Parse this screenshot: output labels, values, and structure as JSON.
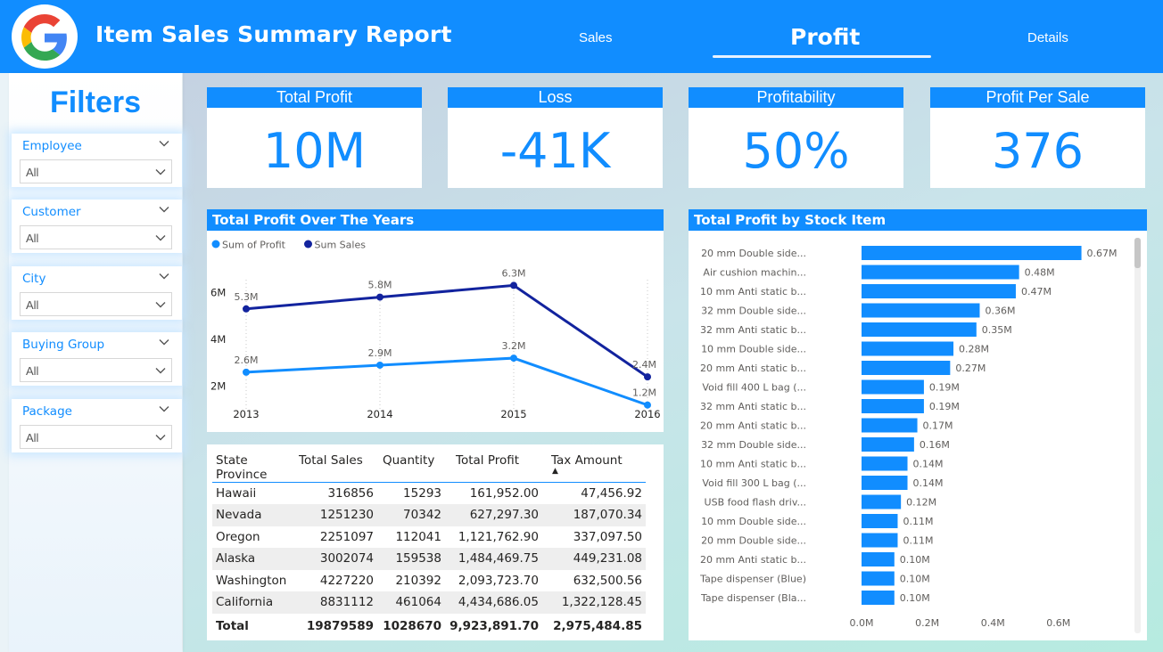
{
  "header": {
    "title": "Item Sales Summary Report",
    "nav": [
      "Sales",
      "Profit",
      "Details"
    ],
    "active_tab": "Profit",
    "logo_icon": "google-logo"
  },
  "filters": {
    "title": "Filters",
    "items": [
      {
        "label": "Employee",
        "value": "All"
      },
      {
        "label": "Customer",
        "value": "All"
      },
      {
        "label": "City",
        "value": "All"
      },
      {
        "label": "Buying Group",
        "value": "All"
      },
      {
        "label": "Package",
        "value": "All"
      }
    ]
  },
  "kpis": [
    {
      "label": "Total Profit",
      "value": "10M"
    },
    {
      "label": "Loss",
      "value": "-41K"
    },
    {
      "label": "Profitability",
      "value": "50%"
    },
    {
      "label": "Profit Per Sale",
      "value": "376"
    }
  ],
  "colors": {
    "accent": "#118DFF",
    "dark_series": "#12239E"
  },
  "line_panel": {
    "title": "Total Profit Over The Years"
  },
  "bar_panel": {
    "title": "Total Profit by Stock Item"
  },
  "table": {
    "columns": [
      "State Province",
      "Total Sales",
      "Quantity",
      "Total Profit",
      "Tax Amount"
    ],
    "sort_indicator": "▲",
    "rows": [
      [
        "Hawaii",
        "316856",
        "15293",
        "161,952.00",
        "47,456.92"
      ],
      [
        "Nevada",
        "1251230",
        "70342",
        "627,297.30",
        "187,070.34"
      ],
      [
        "Oregon",
        "2251097",
        "112041",
        "1,121,762.90",
        "337,097.50"
      ],
      [
        "Alaska",
        "3002074",
        "159538",
        "1,484,469.75",
        "449,231.08"
      ],
      [
        "Washington",
        "4227220",
        "210392",
        "2,093,723.70",
        "632,500.56"
      ],
      [
        "California",
        "8831112",
        "461064",
        "4,434,686.05",
        "1,322,128.45"
      ]
    ],
    "total": [
      "Total",
      "19879589",
      "1028670",
      "9,923,891.70",
      "2,975,484.85"
    ]
  },
  "chart_data": [
    {
      "type": "line",
      "title": "Total Profit Over The Years",
      "x": [
        "2013",
        "2014",
        "2015",
        "2016"
      ],
      "ylim": [
        1000000,
        7000000
      ],
      "yticks": [
        "2M",
        "4M",
        "6M"
      ],
      "legend": "top-left",
      "grid": true,
      "series": [
        {
          "name": "Sum of Profit",
          "values": [
            2600000,
            2900000,
            3200000,
            1200000
          ],
          "labels": [
            "2.6M",
            "2.9M",
            "3.2M",
            "1.2M"
          ],
          "color": "#118DFF"
        },
        {
          "name": "Sum Sales",
          "values": [
            5300000,
            5800000,
            6300000,
            2400000
          ],
          "labels": [
            "5.3M",
            "5.8M",
            "6.3M",
            "2.4M"
          ],
          "color": "#12239E"
        }
      ]
    },
    {
      "type": "bar",
      "orientation": "horizontal",
      "title": "Total Profit by Stock Item",
      "categories": [
        "20 mm Double side...",
        "Air cushion machin...",
        "10 mm Anti static b...",
        "32 mm Double side...",
        "32 mm Anti static b...",
        "10 mm Double side...",
        "20 mm Anti static b...",
        "Void fill 400 L bag (...",
        "32 mm Anti static b...",
        "20 mm Anti static b...",
        "32 mm Double side...",
        "10 mm Anti static b...",
        "Void fill 300 L bag (...",
        "USB food flash driv...",
        "10 mm Double side...",
        "20 mm Double side...",
        "20 mm Anti static b...",
        "Tape dispenser (Blue)",
        "Tape dispenser (Bla..."
      ],
      "values": [
        0.67,
        0.48,
        0.47,
        0.36,
        0.35,
        0.28,
        0.27,
        0.19,
        0.19,
        0.17,
        0.16,
        0.14,
        0.14,
        0.12,
        0.11,
        0.11,
        0.1,
        0.1,
        0.1
      ],
      "labels": [
        "0.67M",
        "0.48M",
        "0.47M",
        "0.36M",
        "0.35M",
        "0.28M",
        "0.27M",
        "0.19M",
        "0.19M",
        "0.17M",
        "0.16M",
        "0.14M",
        "0.14M",
        "0.12M",
        "0.11M",
        "0.11M",
        "0.10M",
        "0.10M",
        "0.10M"
      ],
      "xticks": [
        "0.0M",
        "0.2M",
        "0.4M",
        "0.6M"
      ],
      "xlim": [
        0,
        0.75
      ],
      "unit": "M"
    }
  ]
}
